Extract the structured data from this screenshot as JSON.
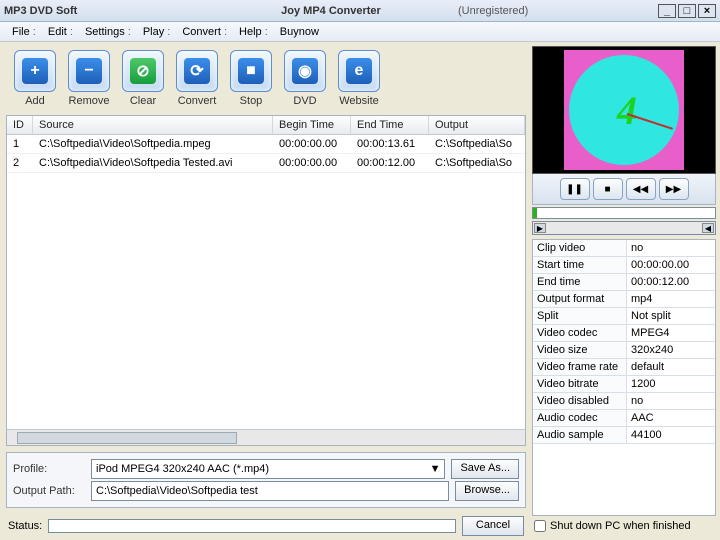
{
  "title": {
    "brand": "MP3 DVD Soft",
    "app": "Joy MP4 Converter",
    "reg": "(Unregistered)"
  },
  "menu": [
    "File",
    "Edit",
    "Settings",
    "Play",
    "Convert",
    "Help",
    "Buynow"
  ],
  "toolbar": {
    "add": "Add",
    "remove": "Remove",
    "clear": "Clear",
    "convert": "Convert",
    "stop": "Stop",
    "dvd": "DVD",
    "website": "Website"
  },
  "cols": {
    "id": "ID",
    "src": "Source",
    "bt": "Begin Time",
    "et": "End Time",
    "out": "Output"
  },
  "rows": [
    {
      "id": "1",
      "src": "C:\\Softpedia\\Video\\Softpedia.mpeg",
      "bt": "00:00:00.00",
      "et": "00:00:13.61",
      "out": "C:\\Softpedia\\So"
    },
    {
      "id": "2",
      "src": "C:\\Softpedia\\Video\\Softpedia Tested.avi",
      "bt": "00:00:00.00",
      "et": "00:00:12.00",
      "out": "C:\\Softpedia\\So"
    }
  ],
  "profile": {
    "label": "Profile:",
    "value": "iPod MPEG4 320x240 AAC (*.mp4)",
    "save": "Save As...",
    "outlabel": "Output Path:",
    "outpath": "C:\\Softpedia\\Video\\Softpedia test",
    "browse": "Browse..."
  },
  "status": {
    "label": "Status:",
    "cancel": "Cancel"
  },
  "props": [
    {
      "k": "Clip video",
      "v": "no"
    },
    {
      "k": "Start time",
      "v": "00:00:00.00"
    },
    {
      "k": "End time",
      "v": "00:00:12.00"
    },
    {
      "k": "Output format",
      "v": "mp4"
    },
    {
      "k": "Split",
      "v": "Not split"
    },
    {
      "k": "Video codec",
      "v": "MPEG4"
    },
    {
      "k": "Video size",
      "v": "320x240"
    },
    {
      "k": "Video frame rate",
      "v": "default"
    },
    {
      "k": "Video bitrate",
      "v": "1200"
    },
    {
      "k": "Video disabled",
      "v": "no"
    },
    {
      "k": "Audio codec",
      "v": "AAC"
    },
    {
      "k": "Audio sample",
      "v": "44100"
    }
  ],
  "shutdown": "Shut down PC when finished",
  "clock_numeral": "4"
}
